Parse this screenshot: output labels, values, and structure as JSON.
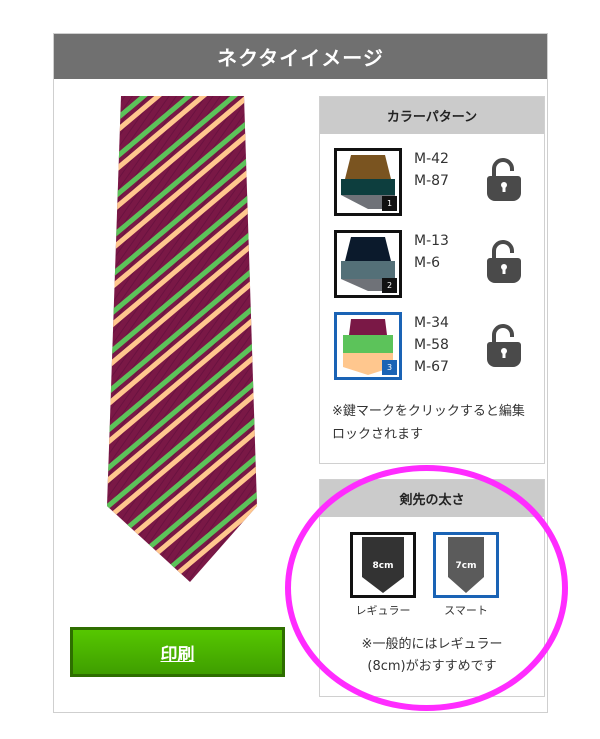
{
  "header": {
    "title": "ネクタイイメージ"
  },
  "print_button": {
    "label": "印刷"
  },
  "colors": {
    "tie_base": "#7a1846",
    "tie_stripe_green": "#5cc35a",
    "tie_stripe_peach": "#ffc78e",
    "header_bg": "#707070",
    "selected_border": "#1a63b5",
    "print_green": "#4fb800",
    "highlight": "#ff2cff"
  },
  "color_pattern": {
    "title": "カラーパターン",
    "patterns": [
      {
        "number": "1",
        "codes": [
          "M-42",
          "M-87"
        ],
        "selected": false,
        "lock_icon": "unlocked-padlock"
      },
      {
        "number": "2",
        "codes": [
          "M-13",
          "M-6"
        ],
        "selected": false,
        "lock_icon": "unlocked-padlock"
      },
      {
        "number": "3",
        "codes": [
          "M-34",
          "M-58",
          "M-67"
        ],
        "selected": true,
        "lock_icon": "unlocked-padlock"
      }
    ],
    "note": "※鍵マークをクリックすると編集ロックされます"
  },
  "tip_width": {
    "title": "剣先の太さ",
    "options": [
      {
        "size": "8cm",
        "label": "レギュラー",
        "selected": false
      },
      {
        "size": "7cm",
        "label": "スマート",
        "selected": true
      }
    ],
    "note_line1": "※一般的にはレギュラー",
    "note_line2": "(8cm)がおすすめです"
  }
}
